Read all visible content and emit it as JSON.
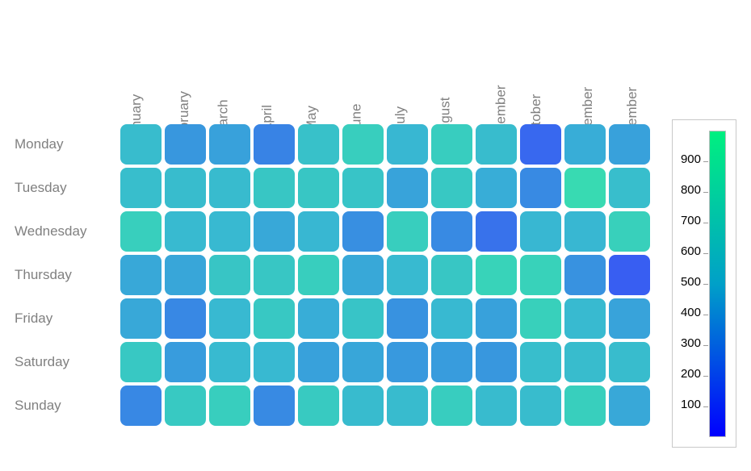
{
  "figure": {
    "background_color": "#ffffff",
    "axis_label_color": "#808080",
    "tick_label_color": "#000000"
  },
  "colorbar": {
    "low_color": "#0000ff",
    "mid_color": "#00a0c8",
    "high_color": "#00f080",
    "border_color": "#c8c8c8",
    "min": 0,
    "max": 1000,
    "ticks": [
      100,
      200,
      300,
      400,
      500,
      600,
      700,
      800,
      900
    ],
    "tick_labels": [
      "100",
      "200",
      "300",
      "400",
      "500",
      "600",
      "700",
      "800",
      "900"
    ]
  },
  "chart_data": {
    "type": "heatmap",
    "title": "",
    "xlabel": "",
    "ylabel": "",
    "grid": false,
    "legend_position": "right",
    "colormap": "winter_reversed",
    "cell_opacity": 0.78,
    "zlim": [
      0,
      1000
    ],
    "x_categories": [
      "January",
      "February",
      "March",
      "April",
      "May",
      "June",
      "July",
      "August",
      "September",
      "October",
      "November",
      "December"
    ],
    "y_categories": [
      "Monday",
      "Tuesday",
      "Wednesday",
      "Thursday",
      "Friday",
      "Saturday",
      "Sunday"
    ],
    "values": [
      [
        560,
        380,
        420,
        300,
        600,
        700,
        520,
        690,
        560,
        190,
        470,
        420
      ],
      [
        570,
        560,
        550,
        640,
        640,
        620,
        430,
        650,
        470,
        330,
        800,
        570
      ],
      [
        710,
        540,
        530,
        450,
        520,
        350,
        700,
        330,
        230,
        520,
        520,
        720
      ],
      [
        450,
        440,
        630,
        640,
        700,
        450,
        540,
        640,
        740,
        730,
        360,
        150
      ],
      [
        450,
        320,
        530,
        650,
        470,
        620,
        360,
        530,
        420,
        720,
        540,
        430
      ],
      [
        650,
        400,
        540,
        530,
        420,
        440,
        390,
        400,
        380,
        570,
        560,
        560
      ],
      [
        320,
        660,
        700,
        330,
        670,
        550,
        550,
        690,
        550,
        560,
        710,
        450
      ]
    ]
  }
}
